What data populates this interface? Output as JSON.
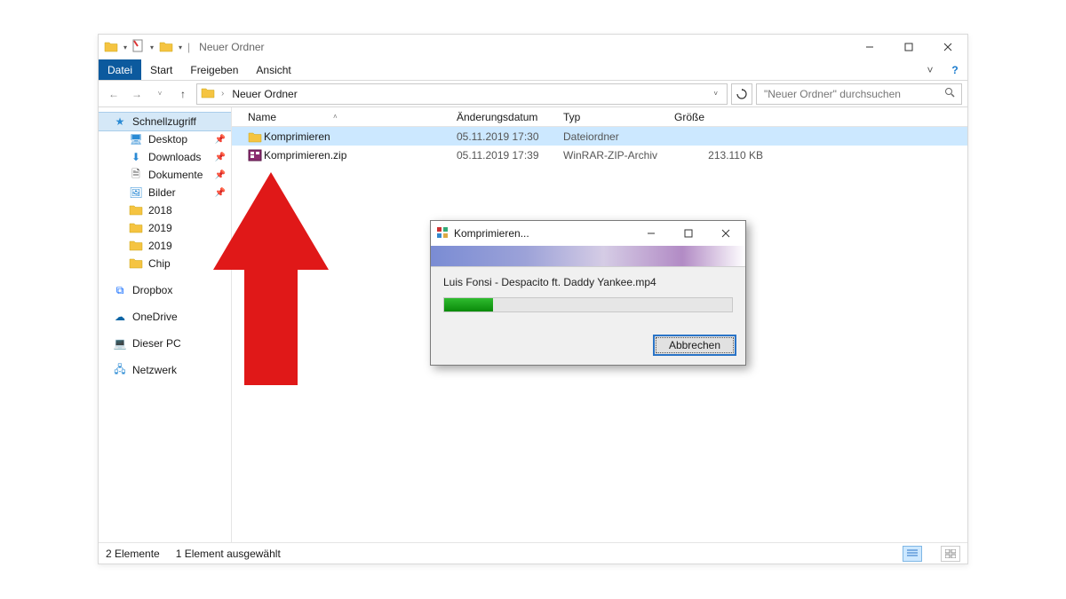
{
  "window": {
    "title": "Neuer Ordner",
    "title_prefix_sep": "|"
  },
  "ribbon": {
    "datei": "Datei",
    "start": "Start",
    "freigeben": "Freigeben",
    "ansicht": "Ansicht"
  },
  "address": {
    "crumb": "Neuer Ordner"
  },
  "search": {
    "placeholder": "\"Neuer Ordner\" durchsuchen"
  },
  "columns": {
    "name": "Name",
    "date": "Änderungsdatum",
    "type": "Typ",
    "size": "Größe"
  },
  "sidebar": {
    "quick": "Schnellzugriff",
    "desktop": "Desktop",
    "downloads": "Downloads",
    "documents": "Dokumente",
    "pictures": "Bilder",
    "f2018": "2018",
    "f2019a": "2019",
    "f2019b": "2019",
    "chip": "Chip",
    "dropbox": "Dropbox",
    "onedrive": "OneDrive",
    "thispc": "Dieser PC",
    "network": "Netzwerk"
  },
  "files": [
    {
      "name": "Komprimieren",
      "date": "05.11.2019 17:30",
      "type": "Dateiordner",
      "size": "",
      "icon": "folder",
      "selected": true
    },
    {
      "name": "Komprimieren.zip",
      "date": "05.11.2019 17:39",
      "type": "WinRAR-ZIP-Archiv",
      "size": "213.110 KB",
      "icon": "zip",
      "selected": false
    }
  ],
  "status": {
    "count": "2 Elemente",
    "selected": "1 Element ausgewählt"
  },
  "dialog": {
    "title": "Komprimieren...",
    "file": "Luis Fonsi - Despacito ft. Daddy Yankee.mp4",
    "cancel": "Abbrechen"
  }
}
